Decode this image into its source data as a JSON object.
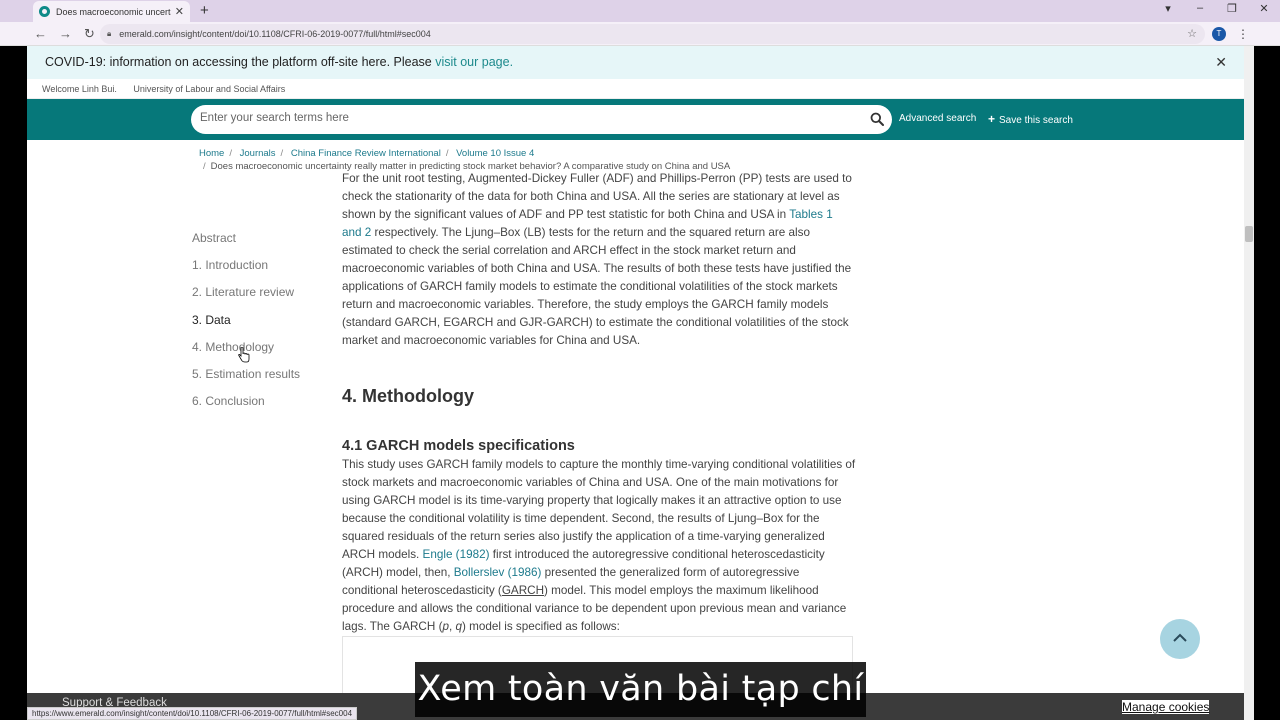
{
  "browser": {
    "tab_title": "Does macroeconomic uncertainty",
    "new_tab": "+",
    "url": "emerald.com/insight/content/doi/10.1108/CFRI-06-2019-0077/full/html#sec004",
    "profile_initial": "T",
    "status_url": "https://www.emerald.com/insight/content/doi/10.1108/CFRI-06-2019-0077/full/html#sec004"
  },
  "banner": {
    "text": "COVID-19: information on accessing the platform off-site here. Please ",
    "link": "visit our page."
  },
  "welcome": {
    "user": "Welcome Linh Bui.",
    "institution": "University of Labour and Social Affairs"
  },
  "search": {
    "placeholder": "Enter your search terms here",
    "advanced": "Advanced search",
    "save": "Save this search"
  },
  "breadcrumb": {
    "home": "Home",
    "journals": "Journals",
    "journal": "China Finance Review International",
    "issue": "Volume 10 Issue 4",
    "article": "Does macroeconomic uncertainty really matter in predicting stock market behavior? A comparative study on China and USA"
  },
  "toc": [
    "Abstract",
    "1. Introduction",
    "2. Literature review",
    "3. Data",
    "4. Methodology",
    "5. Estimation results",
    "6. Conclusion"
  ],
  "article": {
    "para1_a": "For the unit root testing, Augmented-Dickey Fuller (ADF) and Phillips-Perron (PP) tests are used to check the stationarity of the data for both China and USA. All the series are stationary at level as shown by the significant values of ADF and PP test statistic for both China and USA in ",
    "para1_link": "Tables 1 and 2",
    "para1_b": " respectively. The Ljung–Box (LB) tests for the return and the squared return are also estimated to check the serial correlation and ARCH effect in the stock market return and macroeconomic variables of both China and USA. The results of both these tests have justified the applications of GARCH family models to estimate the conditional volatilities of the stock markets return and macroeconomic variables. Therefore, the study employs the GARCH family models (standard GARCH, EGARCH and GJR-GARCH) to estimate the conditional volatilities of the stock market and macroeconomic variables for China and USA.",
    "heading": "4. Methodology",
    "subheading": "4.1 GARCH models specifications",
    "para2_a": "This study uses GARCH family models to capture the monthly time-varying conditional volatilities of stock markets and macroeconomic variables of China and USA. One of the main motivations for using GARCH model is its time-varying property that logically makes it an attractive option to use because the conditional volatility is time dependent. Second, the results of Ljung–Box for the squared residuals of the return series also justify the application of a time-varying generalized ARCH models. ",
    "para2_link1": "Engle (1982)",
    "para2_b": " first introduced the autoregressive conditional heteroscedasticity (ARCH) model, then, ",
    "para2_link2": "Bollerslev (1986)",
    "para2_c": " presented the generalized form of autoregressive conditional heteroscedasticity (",
    "para2_abbr": "GARCH",
    "para2_d": ") model. This model employs the maximum likelihood procedure and allows the conditional variance to be dependent upon previous mean and variance lags. The GARCH (",
    "para2_p": "p",
    "para2_e": ", ",
    "para2_q": "q",
    "para2_f": ") model is specified as follows:"
  },
  "footer": {
    "support": "Support & Feedback",
    "cookies": "Manage cookies"
  },
  "overlay": {
    "subtitle": "Xem toàn văn bài tạp chí"
  },
  "colors": {
    "teal": "#06787a",
    "link": "#1d7a8c",
    "banner_bg": "#e6f6f8",
    "back_to_top": "#a7d4e1"
  }
}
